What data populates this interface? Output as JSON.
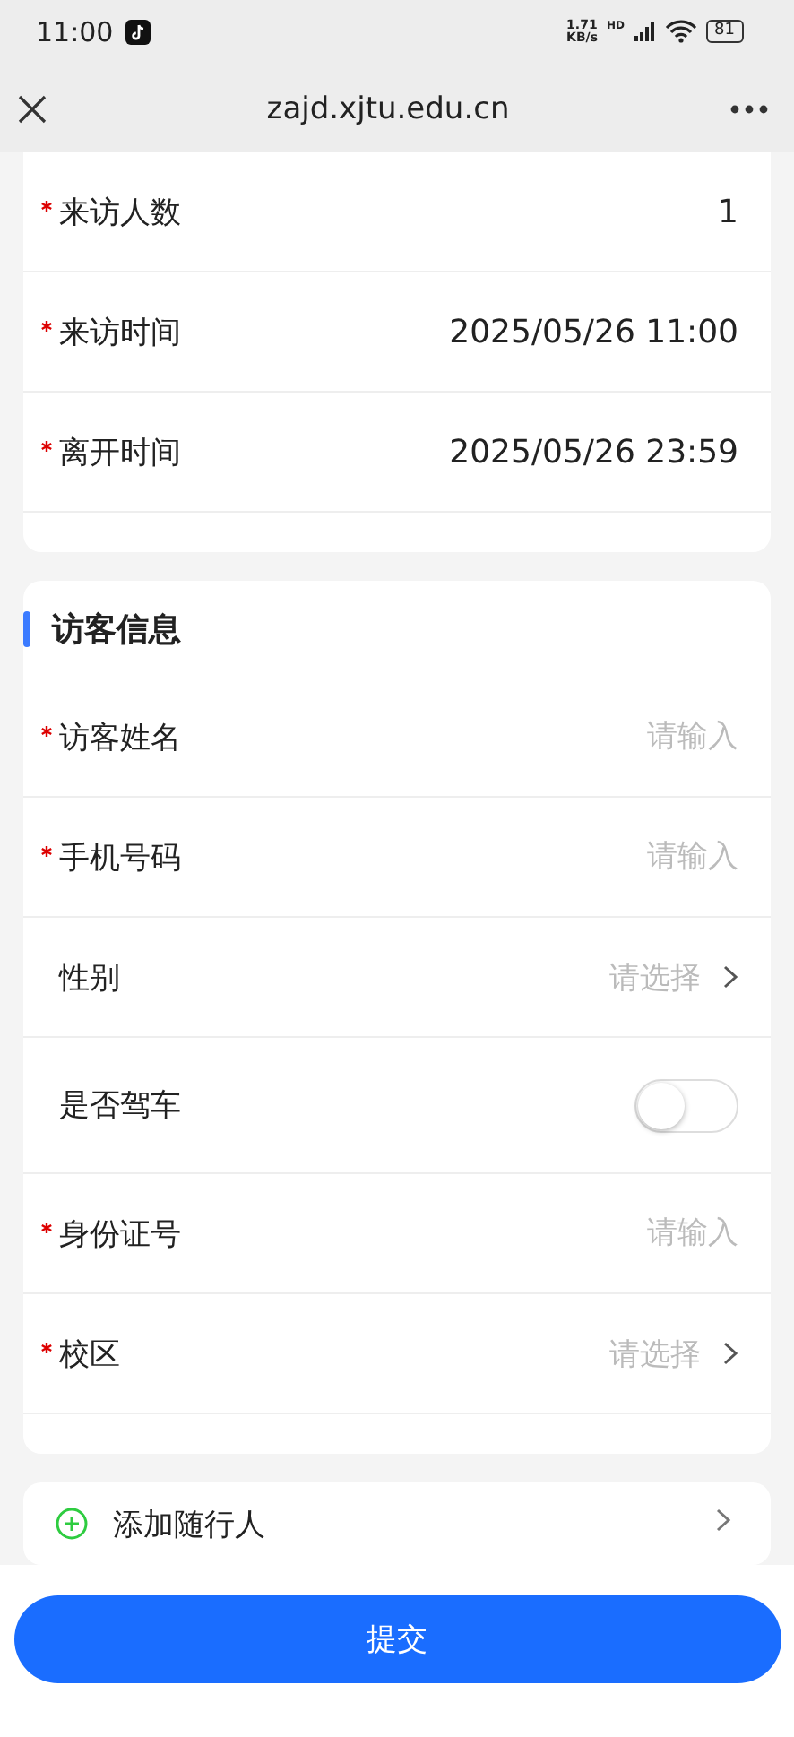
{
  "status_bar": {
    "time": "11:00",
    "speed": "1.71",
    "speed_unit": "KB/s",
    "network": "HD",
    "battery": "81"
  },
  "nav": {
    "title": "zajd.xjtu.edu.cn"
  },
  "visit_card": {
    "rows": [
      {
        "kind": "value",
        "label": "来访人数",
        "required": true,
        "value": "1"
      },
      {
        "kind": "value",
        "label": "来访时间",
        "required": true,
        "value": "2025/05/26 11:00"
      },
      {
        "kind": "value",
        "label": "离开时间",
        "required": true,
        "value": "2025/05/26 23:59"
      }
    ]
  },
  "visitor_card": {
    "title": "访客信息",
    "rows": [
      {
        "kind": "input",
        "label": "访客姓名",
        "required": true,
        "placeholder": "请输入"
      },
      {
        "kind": "input",
        "label": "手机号码",
        "required": true,
        "placeholder": "请输入"
      },
      {
        "kind": "select",
        "label": "性别",
        "required": false,
        "placeholder": "请选择"
      },
      {
        "kind": "switch",
        "label": "是否驾车",
        "required": false,
        "on": false
      },
      {
        "kind": "input",
        "label": "身份证号",
        "required": true,
        "placeholder": "请输入"
      },
      {
        "kind": "select",
        "label": "校区",
        "required": true,
        "placeholder": "请选择"
      }
    ]
  },
  "companion": {
    "label": "添加随行人"
  },
  "submit": {
    "label": "提交"
  }
}
